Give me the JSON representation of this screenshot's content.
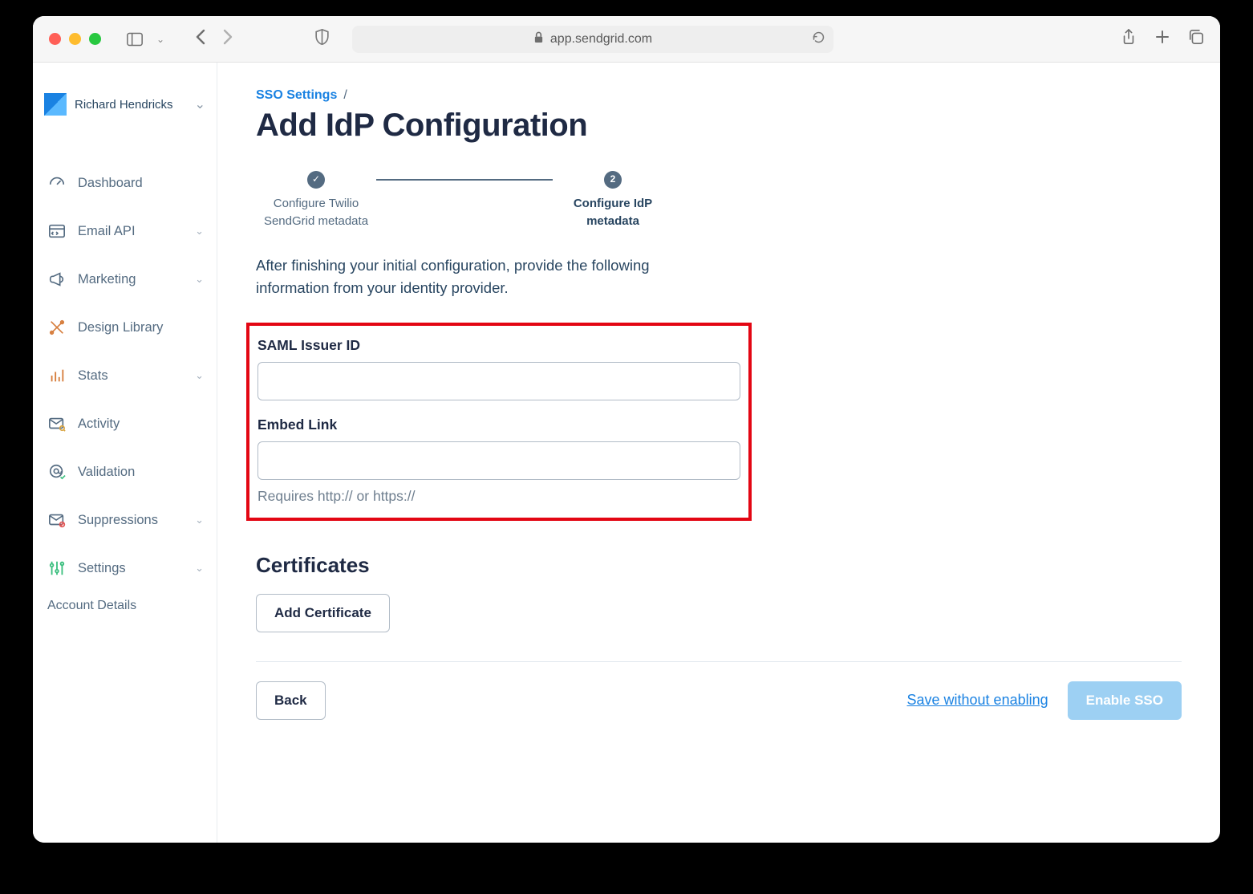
{
  "browser": {
    "url_host": "app.sendgrid.com"
  },
  "user": {
    "name": "Richard Hendricks"
  },
  "sidebar": {
    "items": [
      {
        "label": "Dashboard"
      },
      {
        "label": "Email API"
      },
      {
        "label": "Marketing"
      },
      {
        "label": "Design Library"
      },
      {
        "label": "Stats"
      },
      {
        "label": "Activity"
      },
      {
        "label": "Validation"
      },
      {
        "label": "Suppressions"
      },
      {
        "label": "Settings"
      }
    ],
    "sublink": "Account Details"
  },
  "breadcrumb": {
    "parent": "SSO Settings",
    "sep": "/"
  },
  "page": {
    "title": "Add IdP Configuration",
    "intro": "After finishing your initial configuration, provide the following information from your identity provider."
  },
  "stepper": {
    "step1": {
      "line1": "Configure Twilio",
      "line2": "SendGrid metadata"
    },
    "step2": {
      "num": "2",
      "line1": "Configure IdP",
      "line2": "metadata"
    }
  },
  "form": {
    "saml_label": "SAML Issuer ID",
    "saml_value": "",
    "embed_label": "Embed Link",
    "embed_value": "",
    "embed_hint": "Requires http:// or https://"
  },
  "certificates": {
    "heading": "Certificates",
    "add_button": "Add Certificate"
  },
  "footer": {
    "back": "Back",
    "save_link": "Save without enabling",
    "enable": "Enable SSO"
  }
}
